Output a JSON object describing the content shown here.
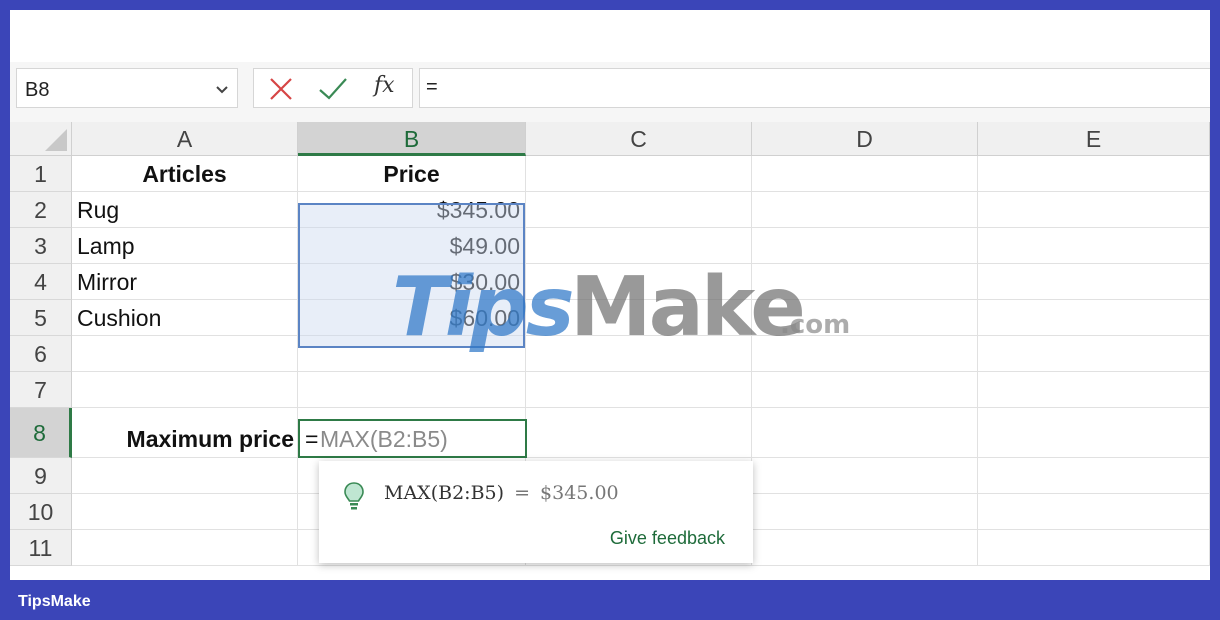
{
  "formula_bar": {
    "name_box": "B8",
    "fx_label": "fx",
    "formula": "="
  },
  "columns": [
    "A",
    "B",
    "C",
    "D",
    "E"
  ],
  "selected_column": "B",
  "rows": [
    "1",
    "2",
    "3",
    "4",
    "5",
    "6",
    "7",
    "8",
    "9",
    "10",
    "11"
  ],
  "selected_row": "8",
  "cells": {
    "A1": "Articles",
    "B1": "Price",
    "A2": "Rug",
    "B2": "$345.00",
    "A3": "Lamp",
    "B3": "$49.00",
    "A4": "Mirror",
    "B4": "$30.00",
    "A5": "Cushion",
    "B5": "$60.00",
    "A8": "Maximum price"
  },
  "active_cell": {
    "typed": "=",
    "suggestion": "MAX(B2:B5)"
  },
  "suggestion_popup": {
    "formula": "MAX(B2:B5)",
    "equals": "=",
    "result": "$345.00",
    "feedback": "Give feedback"
  },
  "watermark": {
    "tips": "Tips",
    "make": "Make",
    "com": ".com"
  },
  "footer_brand": "TipsMake",
  "colors": {
    "accent_green": "#2e7a46",
    "range_blue": "#5b84c4",
    "frame_blue": "#3b45b8"
  }
}
